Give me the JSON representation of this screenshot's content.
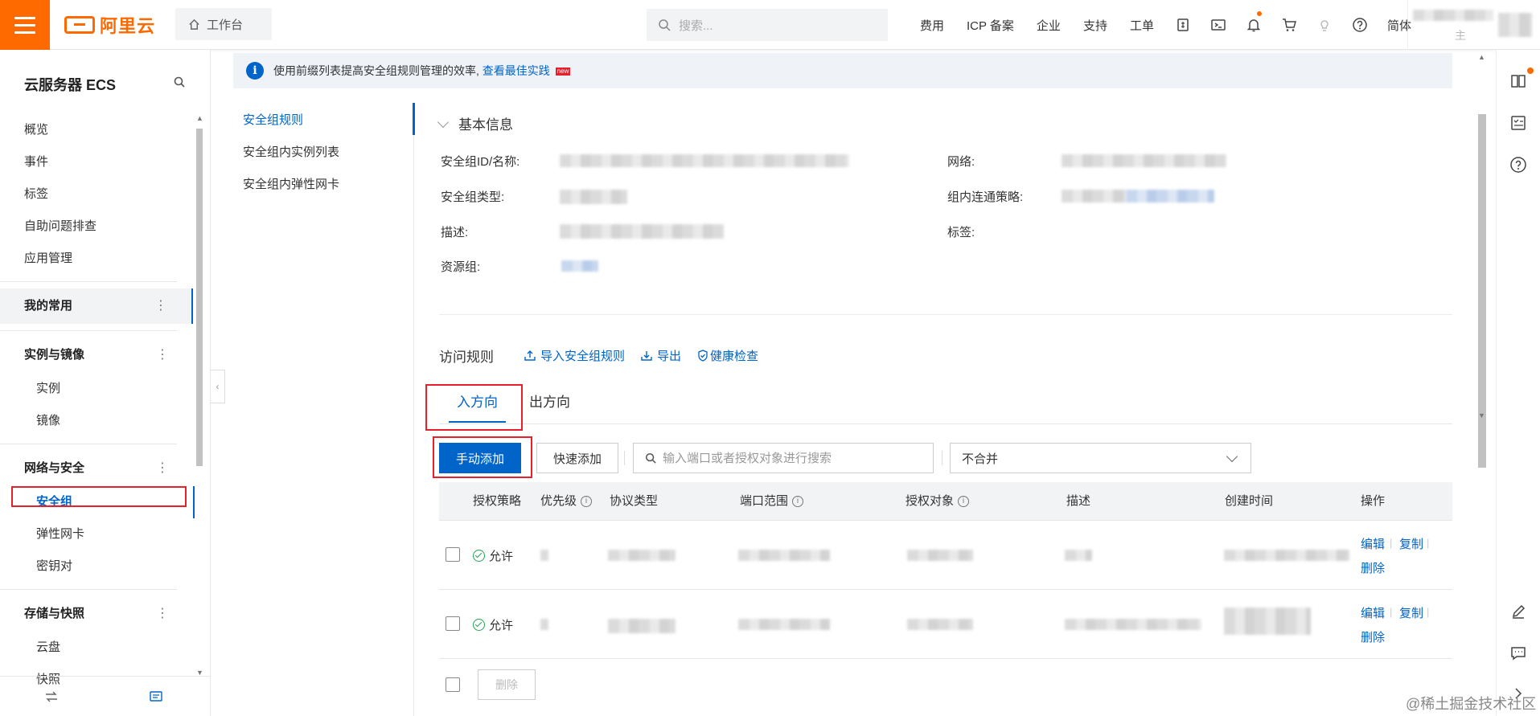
{
  "topbar": {
    "logo_text": "阿里云",
    "workbench": "工作台",
    "search_placeholder": "搜索...",
    "links": [
      "费用",
      "ICP 备案",
      "企业",
      "支持",
      "工单"
    ],
    "lang": "简体",
    "user_partial": "主"
  },
  "sidebar": {
    "title": "云服务器 ECS",
    "top_items": [
      "概览",
      "事件",
      "标签",
      "自助问题排查",
      "应用管理"
    ],
    "favorites": "我的常用",
    "groups": [
      {
        "title": "实例与镜像",
        "items": [
          "实例",
          "镜像"
        ]
      },
      {
        "title": "网络与安全",
        "items": [
          "安全组",
          "弹性网卡",
          "密钥对"
        ]
      },
      {
        "title": "存储与快照",
        "items": [
          "云盘",
          "快照"
        ]
      }
    ]
  },
  "notice": {
    "text": "使用前缀列表提高安全组规则管理的效率,",
    "link": "查看最佳实践",
    "tag": "new"
  },
  "subnav": [
    "安全组规则",
    "安全组内实例列表",
    "安全组内弹性网卡"
  ],
  "basic_info": {
    "title": "基本信息",
    "labels": {
      "id_name": "安全组ID/名称:",
      "network": "网络:",
      "type": "安全组类型:",
      "policy": "组内连通策略:",
      "desc": "描述:",
      "tags": "标签:",
      "resource_group": "资源组:"
    }
  },
  "rules": {
    "title": "访问规则",
    "actions": [
      "导入安全组规则",
      "导出",
      "健康检查"
    ],
    "tabs": [
      "入方向",
      "出方向"
    ],
    "btn_manual": "手动添加",
    "btn_quick": "快速添加",
    "filter_placeholder": "输入端口或者授权对象进行搜索",
    "merge_select": "不合并",
    "columns": [
      "授权策略",
      "优先级",
      "协议类型",
      "端口范围",
      "授权对象",
      "描述",
      "创建时间",
      "操作"
    ],
    "rows": [
      {
        "policy": "允许",
        "ops": [
          "编辑",
          "复制",
          "删除"
        ]
      },
      {
        "policy": "允许",
        "ops": [
          "编辑",
          "复制",
          "删除"
        ]
      }
    ],
    "bulk_delete": "删除"
  },
  "watermark": "@稀土掘金技术社区",
  "colors": {
    "brand": "#ff6a00",
    "primary": "#0064c8",
    "highlight_box": "#e8202b",
    "success": "#23a356"
  }
}
